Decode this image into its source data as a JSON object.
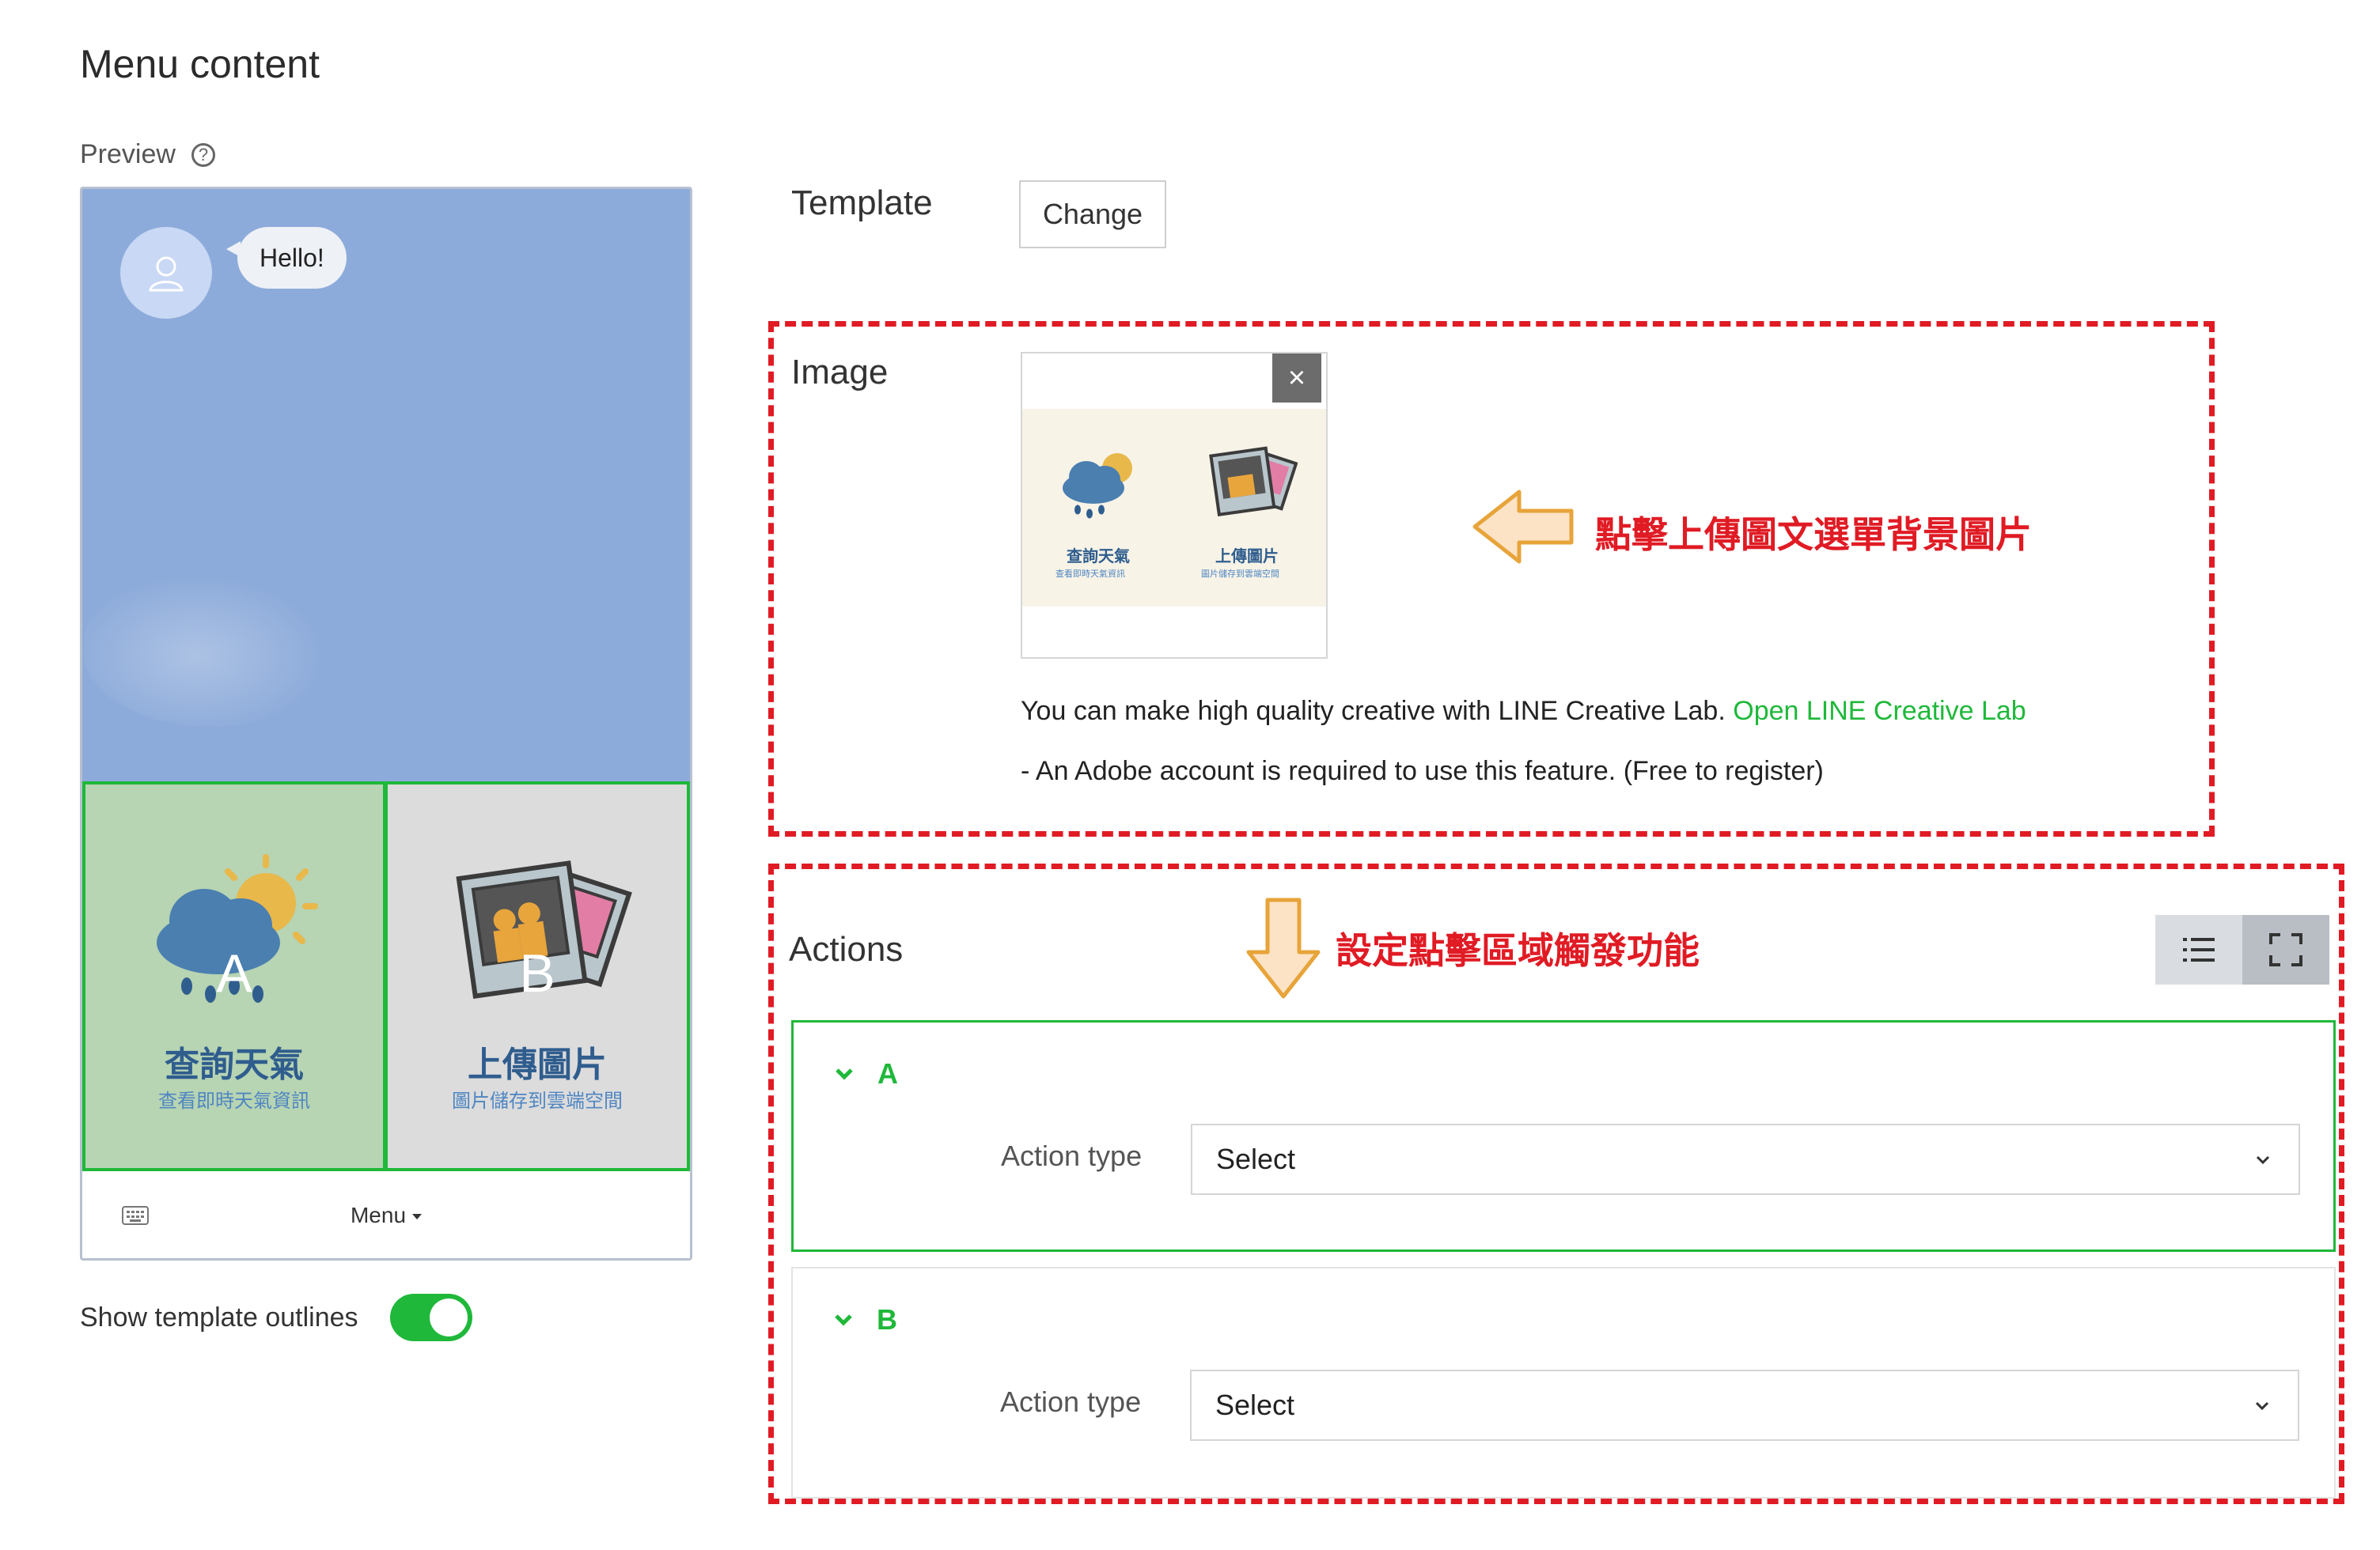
{
  "page": {
    "title": "Menu content"
  },
  "preview": {
    "label": "Preview",
    "help_icon": "question-circle-icon",
    "chat_bubble": "Hello!",
    "rich_menu": [
      {
        "letter": "A",
        "title": "查詢天氣",
        "subtitle": "查看即時天氣資訊"
      },
      {
        "letter": "B",
        "title": "上傳圖片",
        "subtitle": "圖片儲存到雲端空間"
      }
    ],
    "menu_label": "Menu",
    "show_outlines_label": "Show template outlines",
    "show_outlines_on": true
  },
  "template": {
    "label": "Template",
    "change_button": "Change"
  },
  "image": {
    "label": "Image",
    "close": "×",
    "thumb_captions": [
      {
        "title": "查詢天氣",
        "subtitle": "查看即時天氣資訊"
      },
      {
        "title": "上傳圖片",
        "subtitle": "圖片儲存到雲端空間"
      }
    ],
    "info_text": "You can make high quality creative with LINE Creative Lab.",
    "info_link": "Open LINE Creative Lab",
    "note": "- An Adobe account is required to use this feature. (Free to register)"
  },
  "annotations": {
    "image_hint": "點擊上傳圖文選單背景圖片",
    "actions_hint": "設定點擊區域觸發功能"
  },
  "actions": {
    "label": "Actions",
    "items": [
      {
        "name": "A",
        "action_type_label": "Action type",
        "select_value": "Select"
      },
      {
        "name": "B",
        "action_type_label": "Action type",
        "select_value": "Select"
      }
    ]
  },
  "colors": {
    "accent_green": "#1fb83a",
    "annotation_red": "#e01b24",
    "chat_bg": "#8dabda"
  }
}
